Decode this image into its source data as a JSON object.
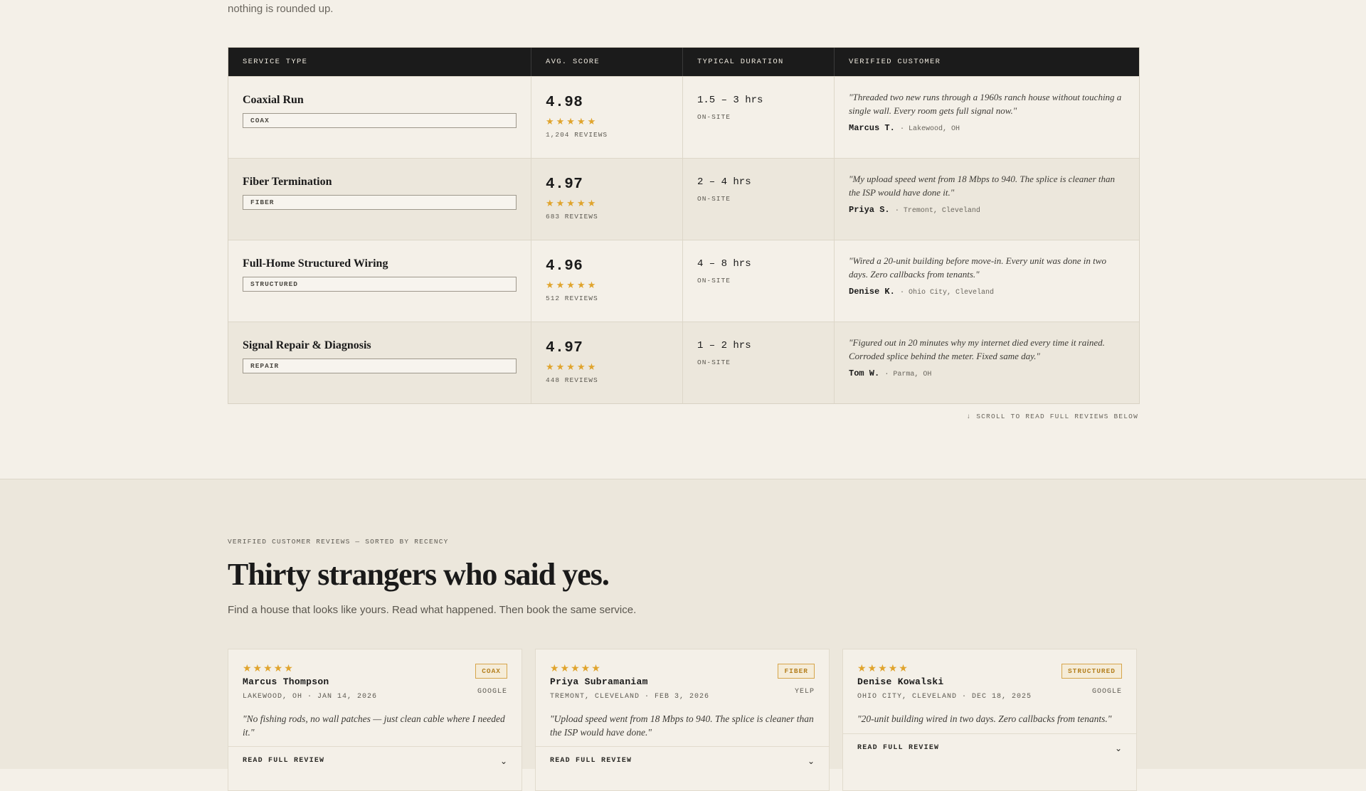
{
  "intro": {
    "tail_text": "nothing is rounded up."
  },
  "table": {
    "headers": [
      "SERVICE TYPE",
      "AVG. SCORE",
      "TYPICAL DURATION",
      "VERIFIED CUSTOMER"
    ],
    "rows": [
      {
        "service": "Coaxial Run",
        "tag": "COAX",
        "score": "4.98",
        "stars": "★★★★★",
        "reviews": "1,204 REVIEWS",
        "duration": "1.5 – 3 hrs",
        "location_type": "ON-SITE",
        "quote": "\"Threaded two new runs through a 1960s ranch house without touching a single wall. Every room gets full signal now.\"",
        "customer": "Marcus T.",
        "customer_loc": "· Lakewood, OH"
      },
      {
        "service": "Fiber Termination",
        "tag": "FIBER",
        "score": "4.97",
        "stars": "★★★★★",
        "reviews": "683 REVIEWS",
        "duration": "2 – 4 hrs",
        "location_type": "ON-SITE",
        "quote": "\"My upload speed went from 18 Mbps to 940. The splice is cleaner than the ISP would have done it.\"",
        "customer": "Priya S.",
        "customer_loc": "· Tremont, Cleveland"
      },
      {
        "service": "Full-Home Structured Wiring",
        "tag": "STRUCTURED",
        "score": "4.96",
        "stars": "★★★★★",
        "reviews": "512 REVIEWS",
        "duration": "4 – 8 hrs",
        "location_type": "ON-SITE",
        "quote": "\"Wired a 20-unit building before move-in. Every unit was done in two days. Zero callbacks from tenants.\"",
        "customer": "Denise K.",
        "customer_loc": "· Ohio City, Cleveland"
      },
      {
        "service": "Signal Repair & Diagnosis",
        "tag": "REPAIR",
        "score": "4.97",
        "stars": "★★★★★",
        "reviews": "448 REVIEWS",
        "duration": "1 – 2 hrs",
        "location_type": "ON-SITE",
        "quote": "\"Figured out in 20 minutes why my internet died every time it rained. Corroded splice behind the meter. Fixed same day.\"",
        "customer": "Tom W.",
        "customer_loc": "· Parma, OH"
      }
    ],
    "scroll_hint": "↓ SCROLL TO READ FULL REVIEWS BELOW"
  },
  "reviews": {
    "eyebrow": "VERIFIED CUSTOMER REVIEWS — SORTED BY RECENCY",
    "title": "Thirty strangers who said yes.",
    "subtitle": "Find a house that looks like yours. Read what happened. Then book the same service.",
    "cards": [
      {
        "stars": "★★★★★",
        "name": "Marcus Thompson",
        "meta": "LAKEWOOD, OH · JAN 14, 2026",
        "tag": "COAX",
        "source": "GOOGLE",
        "quote": "\"No fishing rods, no wall patches — just clean cable where I needed it.\"",
        "read_label": "READ FULL REVIEW",
        "chevron_icon": "chevron-down-icon"
      },
      {
        "stars": "★★★★★",
        "name": "Priya Subramaniam",
        "meta": "TREMONT, CLEVELAND · FEB 3, 2026",
        "tag": "FIBER",
        "source": "YELP",
        "quote": "\"Upload speed went from 18 Mbps to 940. The splice is cleaner than the ISP would have done.\"",
        "read_label": "READ FULL REVIEW",
        "chevron_icon": "chevron-down-icon"
      },
      {
        "stars": "★★★★★",
        "name": "Denise Kowalski",
        "meta": "OHIO CITY, CLEVELAND · DEC 18, 2025",
        "tag": "STRUCTURED",
        "source": "GOOGLE",
        "quote": "\"20-unit building wired in two days. Zero callbacks from tenants.\"",
        "read_label": "READ FULL REVIEW",
        "chevron_icon": "chevron-down-icon"
      }
    ]
  },
  "colors": {
    "star": "#e0a42d",
    "header_bg": "#1b1b1b",
    "page_bg": "#f4f0e8",
    "section_bg": "#ece7dc",
    "tag_accent": "#d6a54a"
  }
}
